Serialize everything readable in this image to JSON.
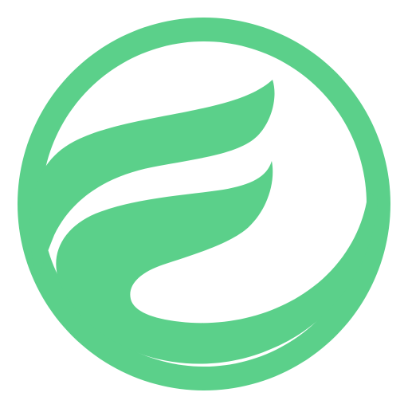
{
  "logo": {
    "icon": "green-leaf-circle-logo-icon",
    "colors": {
      "brand": "#5BD08A",
      "background": "#FFFFFF"
    }
  }
}
